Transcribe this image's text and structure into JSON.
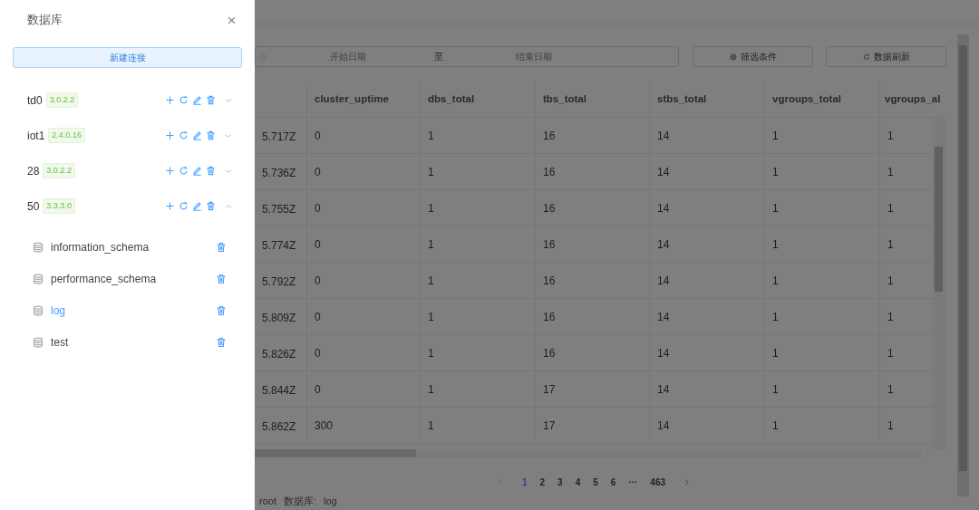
{
  "drawer": {
    "title": "数据库",
    "new_button": "新建连接",
    "connections": [
      {
        "name": "td0",
        "version": "3.0.2.2",
        "expanded": false
      },
      {
        "name": "iot1",
        "version": "2.4.0.16",
        "expanded": false
      },
      {
        "name": "28",
        "version": "3.0.2.2",
        "expanded": false
      },
      {
        "name": "50",
        "version": "3.3.3.0",
        "expanded": true,
        "databases": [
          {
            "name": "information_schema",
            "selected": false
          },
          {
            "name": "performance_schema",
            "selected": false
          },
          {
            "name": "log",
            "selected": true
          },
          {
            "name": "test",
            "selected": false
          }
        ]
      }
    ]
  },
  "filter": {
    "start_placeholder": "开始日期",
    "separator": "至",
    "end_placeholder": "结束日期",
    "buttons": [
      {
        "kind": "filter",
        "label": "筛选条件"
      },
      {
        "kind": "refresh",
        "label": "数据刷新"
      }
    ]
  },
  "table": {
    "columns": [
      "",
      "cluster_uptime",
      "dbs_total",
      "tbs_total",
      "stbs_total",
      "vgroups_total",
      "vgroups_al"
    ],
    "rows": [
      [
        "5.717Z",
        "0",
        "1",
        "16",
        "14",
        "1",
        "1"
      ],
      [
        "5.736Z",
        "0",
        "1",
        "16",
        "14",
        "1",
        "1"
      ],
      [
        "5.755Z",
        "0",
        "1",
        "16",
        "14",
        "1",
        "1"
      ],
      [
        "5.774Z",
        "0",
        "1",
        "16",
        "14",
        "1",
        "1"
      ],
      [
        "5.792Z",
        "0",
        "1",
        "16",
        "14",
        "1",
        "1"
      ],
      [
        "5.809Z",
        "0",
        "1",
        "16",
        "14",
        "1",
        "1"
      ],
      [
        "5.826Z",
        "0",
        "1",
        "16",
        "14",
        "1",
        "1"
      ],
      [
        "5.844Z",
        "0",
        "1",
        "17",
        "14",
        "1",
        "1"
      ],
      [
        "5.862Z",
        "300",
        "1",
        "17",
        "14",
        "1",
        "1"
      ]
    ]
  },
  "pagination": {
    "pages": [
      {
        "label": "1",
        "selected": true
      },
      {
        "label": "2",
        "selected": false
      },
      {
        "label": "3",
        "selected": false
      },
      {
        "label": "4",
        "selected": false
      },
      {
        "label": "5",
        "selected": false
      },
      {
        "label": "6",
        "selected": false
      },
      {
        "label": "···",
        "selected": false
      },
      {
        "label": "463",
        "selected": false
      }
    ]
  },
  "status": {
    "user": "root",
    "db_label": "数据库:",
    "db": "log"
  }
}
